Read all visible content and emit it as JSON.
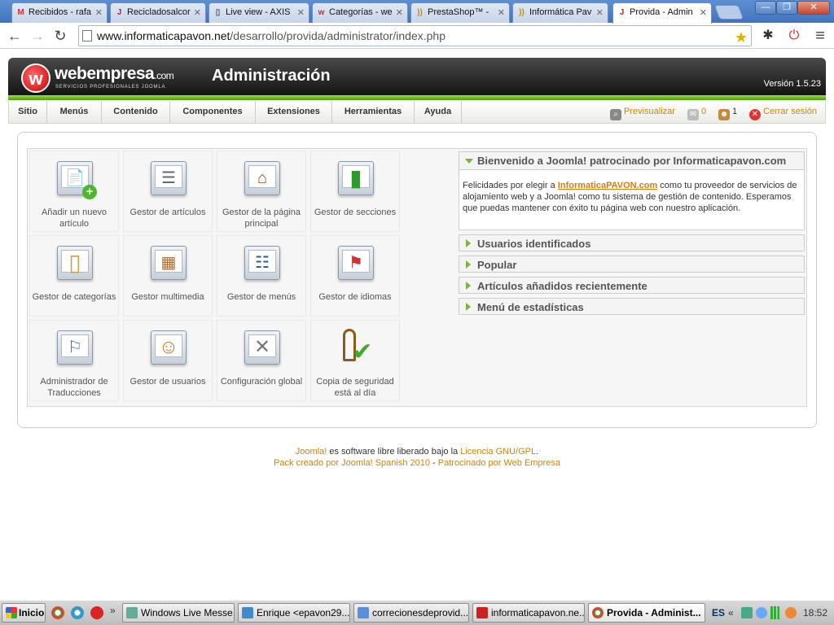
{
  "browser": {
    "tabs": [
      {
        "title": "Recibidos - rafa",
        "icon": "M",
        "color": "#c33"
      },
      {
        "title": "Recicladosalcor",
        "icon": "J",
        "color": "#b22"
      },
      {
        "title": "Live view - AXIS",
        "icon": "▯",
        "color": "#555"
      },
      {
        "title": "Categorías - we",
        "icon": "w",
        "color": "#d22"
      },
      {
        "title": "PrestaShop™ -",
        "icon": "))",
        "color": "#c80"
      },
      {
        "title": "Informática Pav",
        "icon": "))",
        "color": "#c80"
      },
      {
        "title": "Provida - Admin",
        "icon": "J",
        "color": "#b22"
      }
    ],
    "close_glyph": "✕",
    "url_host": "www.informaticapavon.net",
    "url_path": "/desarrollo/provida/administrator/index.php",
    "back": "←",
    "forward": "→",
    "reload": "↻",
    "star": "★",
    "ext1": "✱",
    "ext2": "⏻",
    "menu": "≡",
    "win_min": "—",
    "win_max": "❐",
    "win_close": "✕"
  },
  "joomla": {
    "brand": "webempresa",
    "brand_suffix": ".com",
    "brand_tagline": "SERVICIOS PROFESIONALES JOOMLA",
    "logo_letter": "w",
    "title": "Administración",
    "version": "Versión 1.5.23",
    "menu": [
      "Sitio",
      "Menús",
      "Contenido",
      "Componentes",
      "Extensiones",
      "Herramientas",
      "Ayuda"
    ],
    "status": {
      "preview": "Previsualizar",
      "messages": "0",
      "users": "1",
      "logout": "Cerrar sesión"
    }
  },
  "cpanel": {
    "icons": [
      {
        "label": "Añadir un nuevo artículo",
        "icon": "add-article-icon",
        "glyph": "📄"
      },
      {
        "label": "Gestor de artículos",
        "icon": "article-manager-icon",
        "glyph": "☰"
      },
      {
        "label": "Gestor de la página principal",
        "icon": "frontpage-manager-icon",
        "glyph": "⌂"
      },
      {
        "label": "Gestor de secciones",
        "icon": "section-manager-icon",
        "glyph": "▮"
      },
      {
        "label": "Gestor de categorías",
        "icon": "category-manager-icon",
        "glyph": "▯"
      },
      {
        "label": "Gestor multimedia",
        "icon": "media-manager-icon",
        "glyph": "▦"
      },
      {
        "label": "Gestor de menús",
        "icon": "menu-manager-icon",
        "glyph": "☷"
      },
      {
        "label": "Gestor de idiomas",
        "icon": "language-manager-icon",
        "glyph": "⚑"
      },
      {
        "label": "Administrador de Traducciones",
        "icon": "translation-manager-icon",
        "glyph": "⚐"
      },
      {
        "label": "Gestor de usuarios",
        "icon": "user-manager-icon",
        "glyph": "☺"
      },
      {
        "label": "Configuración global",
        "icon": "global-config-icon",
        "glyph": "✕"
      },
      {
        "label": "Copia de seguridad está al día",
        "icon": "backup-ok-icon",
        "glyph": "✔"
      }
    ]
  },
  "panes": {
    "welcome_title": "Bienvenido a Joomla! patrocinado por Informaticapavon.com",
    "welcome_pre": "Felicidades por elegir a ",
    "welcome_link": "InformaticaPAVON.com",
    "welcome_post": " como tu proveedor de servicios de alojamiento web y a Joomla! como tu sistema de gestión de contenido. Esperamos que puedas mantener con éxito tu página web con nuestro aplicación.",
    "collapsed": [
      "Usuarios identificados",
      "Popular",
      "Artículos añadidos recientemente",
      "Menú de estadísticas"
    ]
  },
  "footer": {
    "joomla": "Joomla!",
    "line1_mid": " es software libre liberado bajo la ",
    "license": "Licencia GNU/GPL",
    "line1_end": ".",
    "pack": "Pack creado por Joomla! Spanish 2010",
    "sep": " - ",
    "sponsor": "Patrocinado por Web Empresa"
  },
  "taskbar": {
    "start": "Inicio",
    "more": "»",
    "items": [
      "Windows Live Messe...",
      "Enrique <epavon29...",
      "correcionesdeprovid...",
      "informaticapavon.ne...",
      "Provida - Administ..."
    ],
    "lang": "ES",
    "tray_more": "«",
    "clock": "18:52"
  }
}
